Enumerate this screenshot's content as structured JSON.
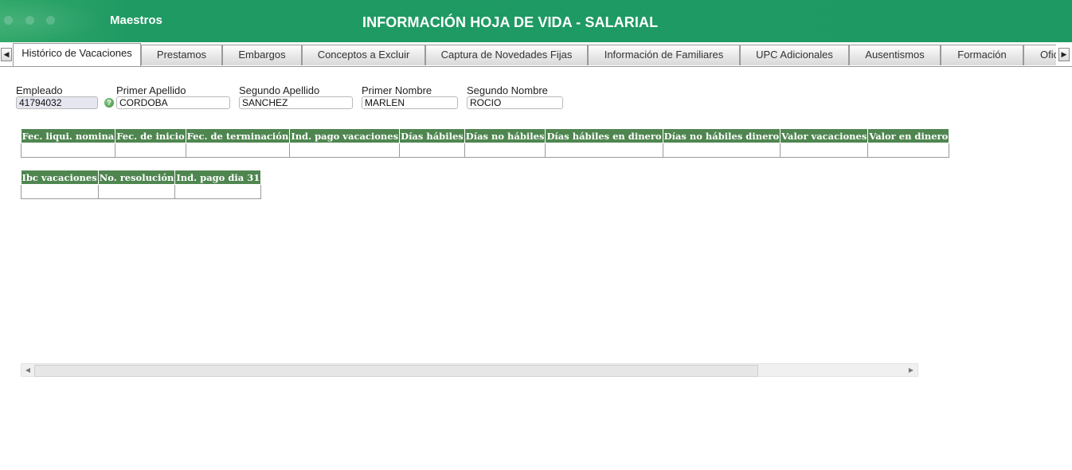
{
  "header": {
    "menu_label": "Maestros",
    "title": "INFORMACIÓN HOJA DE VIDA - SALARIAL",
    "accent_color": "#1e9964"
  },
  "tabs": [
    {
      "label": "Histórico de Vacaciones",
      "active": true
    },
    {
      "label": "Prestamos"
    },
    {
      "label": "Embargos"
    },
    {
      "label": "Conceptos a Excluir"
    },
    {
      "label": "Captura de Novedades Fijas"
    },
    {
      "label": "Información de Familiares"
    },
    {
      "label": "UPC Adicionales"
    },
    {
      "label": "Ausentismos"
    },
    {
      "label": "Formación"
    },
    {
      "label": "Ofic"
    }
  ],
  "employee": {
    "empleado": {
      "label": "Empleado",
      "value": "41794032"
    },
    "primer_apellido": {
      "label": "Primer Apellido",
      "value": "CORDOBA"
    },
    "segundo_apellido": {
      "label": "Segundo Apellido",
      "value": "SANCHEZ"
    },
    "primer_nombre": {
      "label": "Primer Nombre",
      "value": "MARLEN"
    },
    "segundo_nombre": {
      "label": "Segundo Nombre",
      "value": "ROCIO"
    },
    "help_icon": "question-icon"
  },
  "vacations_table": {
    "headers": [
      "Fec. liqui. nomina",
      "Fec. de inicio",
      "Fec. de terminación",
      "Ind. pago vacaciones",
      "Días hábiles",
      "Días no hábiles",
      "Días hábiles en dinero",
      "Días no hábiles dinero",
      "Valor vacaciones",
      "Valor en dinero"
    ],
    "header_color": "#4f8650"
  },
  "extra_table": {
    "headers": [
      "Ibc vacaciones",
      "No. resolución",
      "Ind. pago dia 31"
    ]
  }
}
